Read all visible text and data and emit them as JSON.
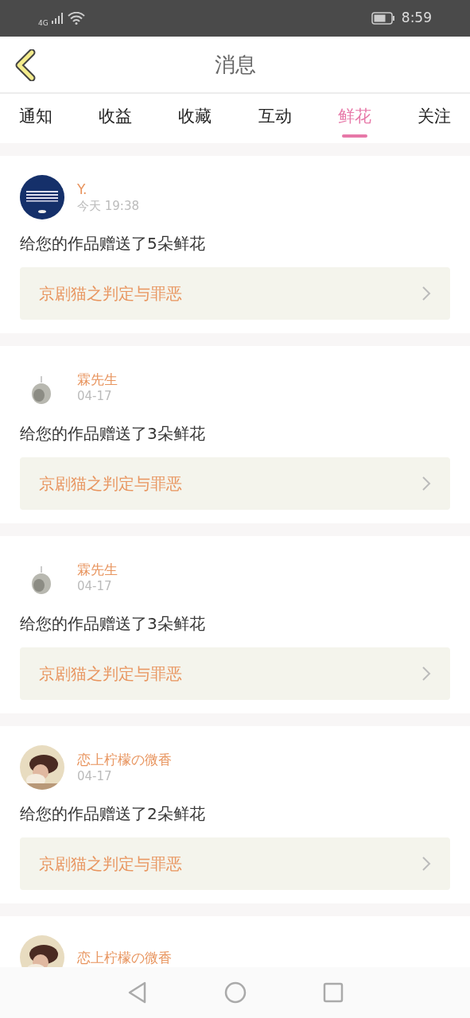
{
  "status_bar": {
    "time": "8:59",
    "network": "4G"
  },
  "header": {
    "title": "消息"
  },
  "tabs": [
    {
      "label": "通知",
      "selected": false
    },
    {
      "label": "收益",
      "selected": false
    },
    {
      "label": "收藏",
      "selected": false
    },
    {
      "label": "互动",
      "selected": false
    },
    {
      "label": "鲜花",
      "selected": true
    },
    {
      "label": "关注",
      "selected": false
    }
  ],
  "messages": [
    {
      "user": "Y.",
      "time": "今天 19:38",
      "text": "给您的作品赠送了5朵鲜花",
      "work": "京剧猫之判定与罪恶"
    },
    {
      "user": "霖先生",
      "time": "04-17",
      "text": "给您的作品赠送了3朵鲜花",
      "work": "京剧猫之判定与罪恶"
    },
    {
      "user": "霖先生",
      "time": "04-17",
      "text": "给您的作品赠送了3朵鲜花",
      "work": "京剧猫之判定与罪恶"
    },
    {
      "user": "恋上柠檬の微香",
      "time": "04-17",
      "text": "给您的作品赠送了2朵鲜花",
      "work": "京剧猫之判定与罪恶"
    },
    {
      "user": "恋上柠檬の微香"
    }
  ]
}
